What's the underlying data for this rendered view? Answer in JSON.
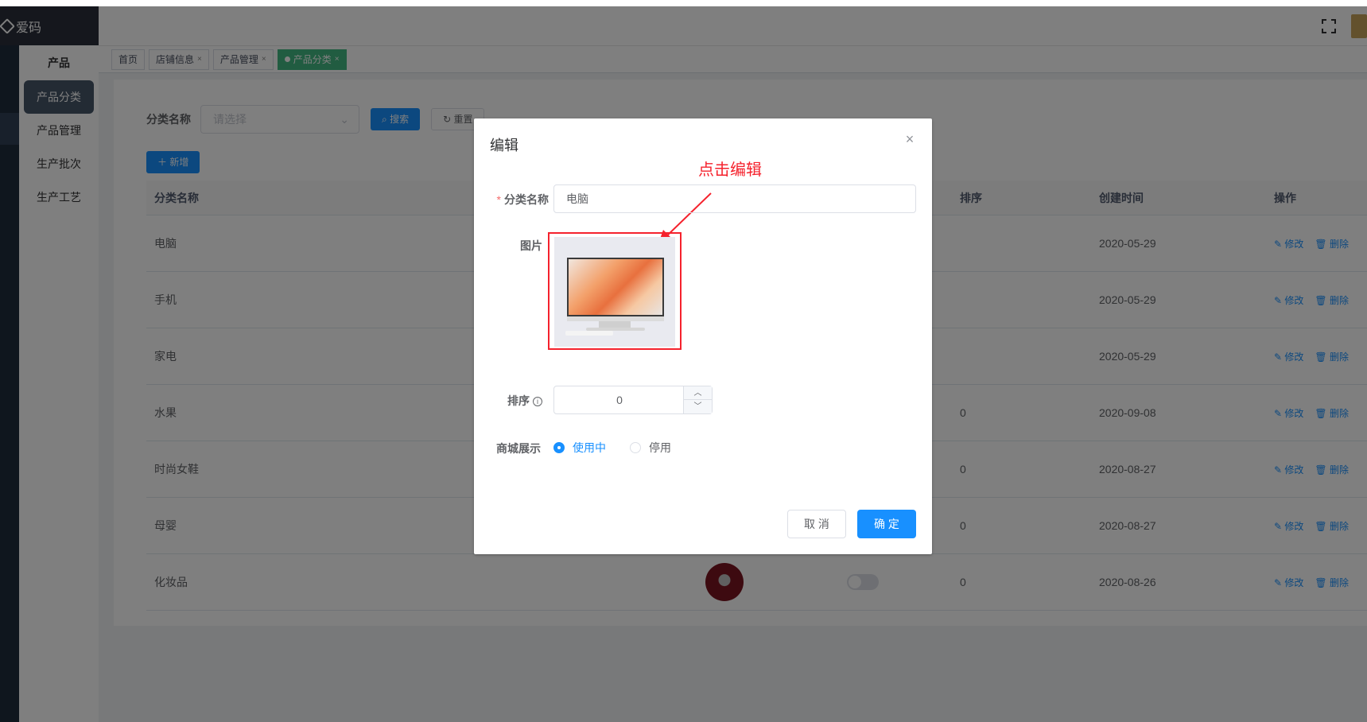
{
  "logo": {
    "text": "爱码"
  },
  "sidebar": {
    "title": "产品",
    "items": [
      {
        "label": "产品分类",
        "active": true
      },
      {
        "label": "产品管理"
      },
      {
        "label": "生产批次"
      },
      {
        "label": "生产工艺"
      }
    ]
  },
  "tags": [
    {
      "label": "首页"
    },
    {
      "label": "店铺信息"
    },
    {
      "label": "产品管理"
    },
    {
      "label": "产品分类",
      "active": true
    }
  ],
  "tag_close": "×",
  "search": {
    "label": "分类名称",
    "placeholder": "请选择",
    "search_btn": "搜索",
    "reset_btn": "重置"
  },
  "add_btn": "新增",
  "table": {
    "headers": [
      "分类名称",
      "",
      "",
      "排序",
      "创建时间",
      "操作"
    ],
    "rows": [
      {
        "name": "电脑",
        "sort": "",
        "created": "2020-05-29"
      },
      {
        "name": "手机",
        "sort": "",
        "created": "2020-05-29"
      },
      {
        "name": "家电",
        "sort": "",
        "created": "2020-05-29"
      },
      {
        "name": "水果",
        "sort": "0",
        "created": "2020-09-08"
      },
      {
        "name": "时尚女鞋",
        "sort": "0",
        "created": "2020-08-27"
      },
      {
        "name": "母婴",
        "sort": "0",
        "created": "2020-08-27"
      },
      {
        "name": "化妆品",
        "sort": "0",
        "created": "2020-08-26"
      }
    ],
    "edit_label": "修改",
    "delete_label": "删除"
  },
  "dialog": {
    "title": "编辑",
    "note": "点击编辑",
    "name_label": "分类名称",
    "name_value": "电脑",
    "image_label": "图片",
    "sort_label": "排序",
    "sort_value": "0",
    "display_label": "商城展示",
    "opt_on": "使用中",
    "opt_off": "停用",
    "cancel": "取 消",
    "ok": "确 定"
  },
  "colors": {
    "primary": "#1890ff",
    "tag_active": "#42b983",
    "annotation": "#f5222d"
  }
}
